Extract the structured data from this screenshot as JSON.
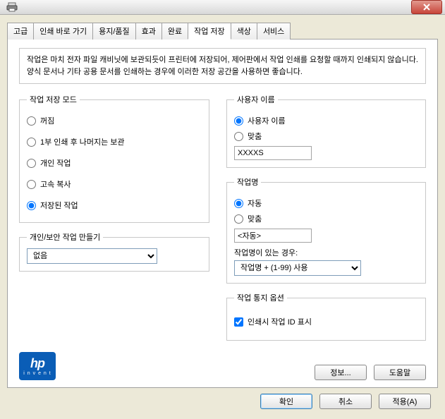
{
  "titlebar": {
    "close_label": "X"
  },
  "tabs": [
    "고급",
    "인쇄 바로 가기",
    "용지/품질",
    "효과",
    "완료",
    "작업 저장",
    "색상",
    "서비스"
  ],
  "active_tab_index": 5,
  "description": "작업은 마치 전자 파일 캐비닛에 보관되듯이 프린터에 저장되어, 제어판에서 작업 인쇄를 요청할 때까지 인쇄되지 않습니다. 양식 문서나 기타 공용 문서를 인쇄하는 경우에 이러한 저장 공간을 사용하면 좋습니다.",
  "left": {
    "storage_mode": {
      "legend": "작업 저장 모드",
      "options": [
        "꺼짐",
        "1부 인쇄 후 나머지는 보관",
        "개인 작업",
        "고속 복사",
        "저장된 작업"
      ],
      "selected_index": 4
    },
    "private": {
      "legend": "개인/보안 작업 만들기",
      "value": "없음"
    }
  },
  "right": {
    "user": {
      "legend": "사용자 이름",
      "opt_user": "사용자 이름",
      "opt_custom": "맞춤",
      "selected": "user",
      "value": "XXXXS"
    },
    "jobname": {
      "legend": "작업명",
      "opt_auto": "자동",
      "opt_custom": "맞춤",
      "selected": "auto",
      "value": "<자동>",
      "exists_label": "작업명이 있는 경우:",
      "exists_value": "작업명 + (1-99) 사용"
    },
    "notify": {
      "legend": "작업 통지 옵션",
      "show_id_label": "인쇄시 작업 ID 표시",
      "show_id_checked": true
    }
  },
  "inner_buttons": {
    "info": "정보...",
    "help": "도움말"
  },
  "dialog_buttons": {
    "ok": "확인",
    "cancel": "취소",
    "apply": "적용(A)"
  },
  "logo": {
    "hp": "hp",
    "invent": "i n v e n t"
  }
}
